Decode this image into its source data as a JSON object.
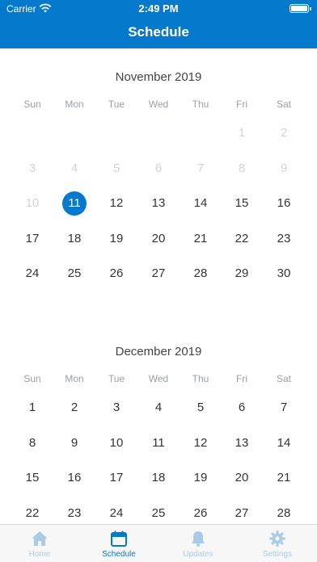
{
  "status": {
    "carrier": "Carrier",
    "time": "2:49 PM"
  },
  "nav": {
    "title": "Schedule"
  },
  "weekdays": [
    "Sun",
    "Mon",
    "Tue",
    "Wed",
    "Thu",
    "Fri",
    "Sat"
  ],
  "months": [
    {
      "title": "November 2019",
      "rows": [
        [
          null,
          null,
          null,
          null,
          null,
          "1",
          "2"
        ],
        [
          "3",
          "4",
          "5",
          "6",
          "7",
          "8",
          "9"
        ],
        [
          "10",
          "11",
          "12",
          "13",
          "14",
          "15",
          "16"
        ],
        [
          "17",
          "18",
          "19",
          "20",
          "21",
          "22",
          "23"
        ],
        [
          "24",
          "25",
          "26",
          "27",
          "28",
          "29",
          "30"
        ]
      ],
      "disabled_days": [
        "1",
        "2",
        "3",
        "4",
        "5",
        "6",
        "7",
        "8",
        "9",
        "10"
      ],
      "selected_day": "11"
    },
    {
      "title": "December 2019",
      "rows": [
        [
          "1",
          "2",
          "3",
          "4",
          "5",
          "6",
          "7"
        ],
        [
          "8",
          "9",
          "10",
          "11",
          "12",
          "13",
          "14"
        ],
        [
          "15",
          "16",
          "17",
          "18",
          "19",
          "20",
          "21"
        ],
        [
          "22",
          "23",
          "24",
          "25",
          "26",
          "27",
          "28"
        ]
      ],
      "disabled_days": [],
      "selected_day": null
    }
  ],
  "tabs": [
    {
      "label": "Home",
      "icon": "home-icon",
      "active": false
    },
    {
      "label": "Schedule",
      "icon": "calendar-icon",
      "active": true
    },
    {
      "label": "Updates",
      "icon": "bell-icon",
      "active": false
    },
    {
      "label": "Settings",
      "icon": "gear-icon",
      "active": false
    }
  ],
  "colors": {
    "accent": "#0579cc",
    "disabled": "#d3d3d3",
    "inactive_tab": "#a9cbe8"
  }
}
